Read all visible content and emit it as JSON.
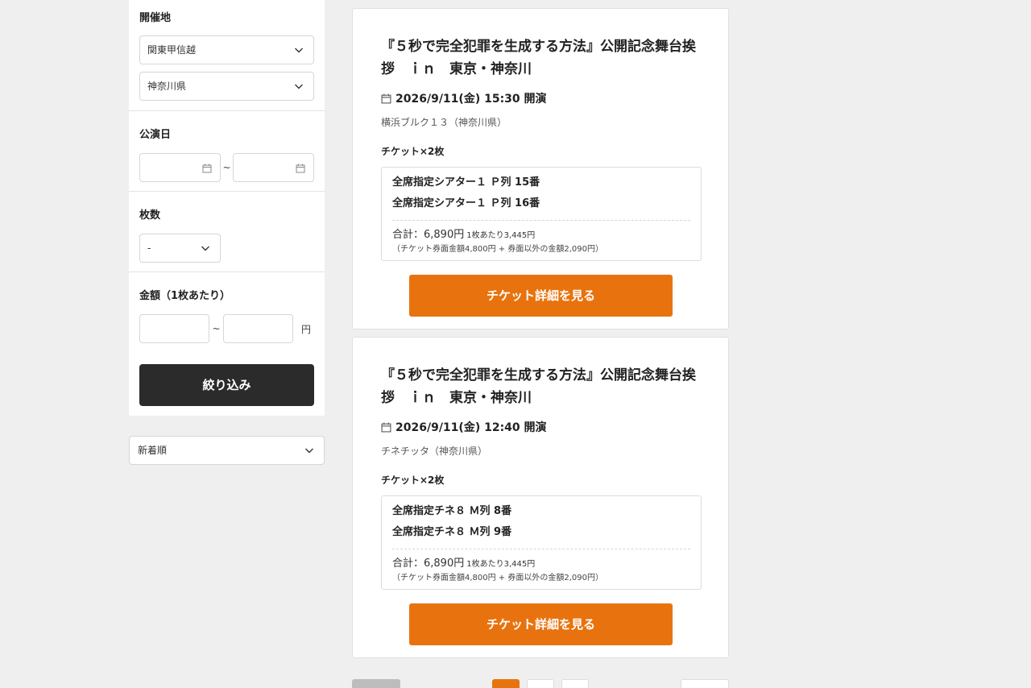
{
  "filters": {
    "venue": {
      "label": "開催地",
      "region_value": "関東甲信越",
      "prefecture_value": "神奈川県"
    },
    "date": {
      "label": "公演日",
      "separator": "~"
    },
    "quantity": {
      "label": "枚数",
      "value": "-"
    },
    "price": {
      "label": "金額（1枚あたり）",
      "separator": "~",
      "unit": "円"
    },
    "submit_label": "絞り込み"
  },
  "sort": {
    "value": "新着順"
  },
  "listings": [
    {
      "title": "『５秒で完全犯罪を生成する方法』公開記念舞台挨拶　ｉｎ　東京・神奈川",
      "datetime": "2026/9/11(金) 15:30 開演",
      "venue": "横浜ブルク１３（神奈川県）",
      "ticket_count": "チケット×2枚",
      "seats": [
        "全席指定シアター１ Ｐ列 15番",
        "全席指定シアター１ Ｐ列 16番"
      ],
      "total": "合計：6,890円",
      "per_ticket": "1枚あたり3,445円",
      "breakdown": "（チケット券面金額4,800円 + 券面以外の金額2,090円）",
      "button_label": "チケット詳細を見る"
    },
    {
      "title": "『５秒で完全犯罪を生成する方法』公開記念舞台挨拶　ｉｎ　東京・神奈川",
      "datetime": "2026/9/11(金) 12:40 開演",
      "venue": "チネチッタ（神奈川県）",
      "ticket_count": "チケット×2枚",
      "seats": [
        "全席指定チネ８ Ｍ列 8番",
        "全席指定チネ８ Ｍ列 9番"
      ],
      "total": "合計：6,890円",
      "per_ticket": "1枚あたり3,445円",
      "breakdown": "（チケット券面金額4,800円 + 券面以外の金額2,090円）",
      "button_label": "チケット詳細を見る"
    }
  ],
  "colors": {
    "accent": "#e8730e",
    "dark_button": "#2b2b2b",
    "background": "#efefef"
  }
}
